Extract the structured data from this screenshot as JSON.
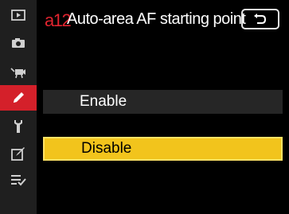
{
  "header": {
    "code": "a12",
    "title": "Auto-area AF starting point",
    "back_icon": "back-arrow-icon"
  },
  "sidebar": {
    "items": [
      {
        "icon": "playback-icon",
        "active": false
      },
      {
        "icon": "camera-icon",
        "active": false
      },
      {
        "icon": "movie-icon",
        "active": false
      },
      {
        "icon": "pencil-icon",
        "active": true
      },
      {
        "icon": "wrench-icon",
        "active": false
      },
      {
        "icon": "retouch-icon",
        "active": false
      },
      {
        "icon": "my-menu-icon",
        "active": false
      }
    ]
  },
  "options": [
    {
      "label": "Enable",
      "selected": false
    },
    {
      "label": "Disable",
      "selected": true
    }
  ],
  "colors": {
    "accent_red": "#d4202a",
    "highlight_yellow": "#f2c41c",
    "sidebar_bg": "#1f1f1f"
  }
}
